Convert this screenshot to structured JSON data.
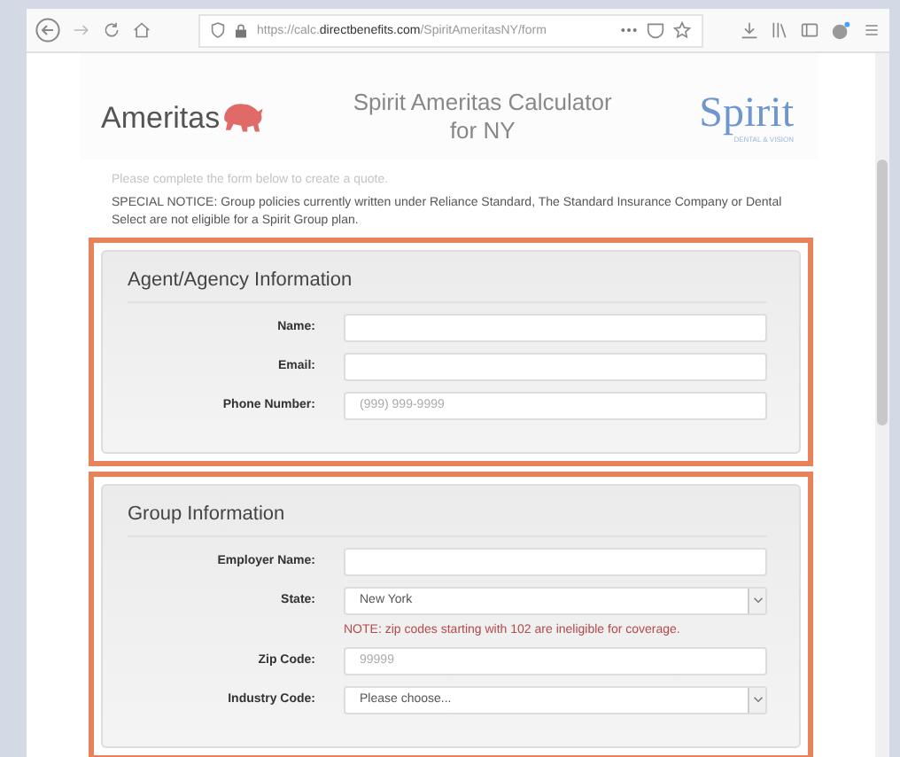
{
  "browser": {
    "url_prefix": "https://calc.",
    "url_domain": "directbenefits.com",
    "url_path": "/SpiritAmeritasNY/form"
  },
  "header": {
    "left_logo": "Ameritas",
    "title": "Spirit Ameritas Calculator for NY",
    "right_logo": "Spirit",
    "right_logo_sub": "DENTAL & VISION"
  },
  "intro": "Please complete the form below to create a quote.",
  "notice": "SPECIAL NOTICE: Group policies currently written under Reliance Standard, The Standard Insurance Company or Dental Select are not eligible for a Spirit Group plan.",
  "sections": [
    {
      "title": "Agent/Agency Information",
      "fields": [
        {
          "kind": "text",
          "label": "Name:"
        },
        {
          "kind": "text",
          "label": "Email:"
        },
        {
          "kind": "text",
          "label": "Phone Number:",
          "placeholder": "(999) 999-9999"
        }
      ]
    },
    {
      "title": "Group Information",
      "fields": [
        {
          "kind": "text",
          "label": "Employer Name:"
        },
        {
          "kind": "select",
          "label": "State:",
          "value": "New York"
        },
        {
          "kind": "note",
          "text": "NOTE: zip codes starting with 102 are ineligible for coverage."
        },
        {
          "kind": "text",
          "label": "Zip Code:",
          "placeholder": "99999"
        },
        {
          "kind": "select",
          "label": "Industry Code:",
          "value": "Please choose..."
        }
      ]
    }
  ]
}
